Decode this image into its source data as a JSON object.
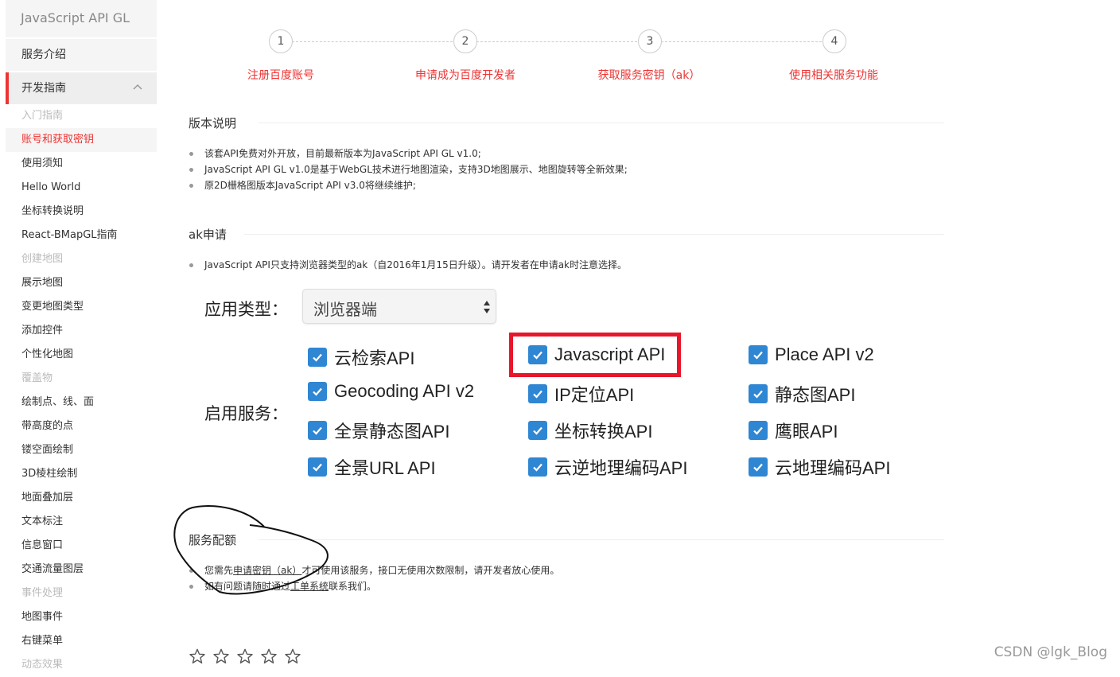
{
  "sidebar": {
    "brand": "JavaScript API GL",
    "top_items": [
      {
        "label": "服务介绍"
      },
      {
        "label": "开发指南"
      }
    ],
    "items": [
      {
        "label": "入门指南",
        "type": "category"
      },
      {
        "label": "账号和获取密钥",
        "type": "active"
      },
      {
        "label": "使用须知",
        "type": "item"
      },
      {
        "label": "Hello World",
        "type": "item"
      },
      {
        "label": "坐标转换说明",
        "type": "item"
      },
      {
        "label": "React-BMapGL指南",
        "type": "item"
      },
      {
        "label": "创建地图",
        "type": "category"
      },
      {
        "label": "展示地图",
        "type": "item"
      },
      {
        "label": "变更地图类型",
        "type": "item"
      },
      {
        "label": "添加控件",
        "type": "item"
      },
      {
        "label": "个性化地图",
        "type": "item"
      },
      {
        "label": "覆盖物",
        "type": "category"
      },
      {
        "label": "绘制点、线、面",
        "type": "item"
      },
      {
        "label": "带高度的点",
        "type": "item"
      },
      {
        "label": "镂空面绘制",
        "type": "item"
      },
      {
        "label": "3D棱柱绘制",
        "type": "item"
      },
      {
        "label": "地面叠加层",
        "type": "item"
      },
      {
        "label": "文本标注",
        "type": "item"
      },
      {
        "label": "信息窗口",
        "type": "item"
      },
      {
        "label": "交通流量图层",
        "type": "item"
      },
      {
        "label": "事件处理",
        "type": "category"
      },
      {
        "label": "地图事件",
        "type": "item"
      },
      {
        "label": "右键菜单",
        "type": "item"
      },
      {
        "label": "动态效果",
        "type": "category"
      }
    ]
  },
  "steps": [
    {
      "num": "1",
      "label": "注册百度账号"
    },
    {
      "num": "2",
      "label": "申请成为百度开发者"
    },
    {
      "num": "3",
      "label": "获取服务密钥（ak）"
    },
    {
      "num": "4",
      "label": "使用相关服务功能"
    }
  ],
  "version": {
    "title": "版本说明",
    "bullets": [
      "该套API免费对外开放，目前最新版本为JavaScript API GL v1.0;",
      "JavaScript API GL v1.0是基于WebGL技术进行地图渲染，支持3D地图展示、地图旋转等全新效果;",
      "原2D栅格图版本JavaScript API v3.0将继续维护;"
    ]
  },
  "ak": {
    "title": "ak申请",
    "bullet": "JavaScript API只支持浏览器类型的ak（自2016年1月15日升级）。请开发者在申请ak时注意选择。",
    "app_type_label": "应用类型：",
    "app_type_value": "浏览器端",
    "services_label": "启用服务：",
    "services": [
      {
        "label": "云检索API",
        "checked": true
      },
      {
        "label": "Javascript API",
        "checked": true,
        "highlighted": true
      },
      {
        "label": "Place API v2",
        "checked": true
      },
      {
        "label": "Geocoding API v2",
        "checked": true
      },
      {
        "label": "IP定位API",
        "checked": true
      },
      {
        "label": "静态图API",
        "checked": true
      },
      {
        "label": "全景静态图API",
        "checked": true
      },
      {
        "label": "坐标转换API",
        "checked": true
      },
      {
        "label": "鹰眼API",
        "checked": true
      },
      {
        "label": "全景URL API",
        "checked": true
      },
      {
        "label": "云逆地理编码API",
        "checked": true
      },
      {
        "label": "云地理编码API",
        "checked": true
      }
    ]
  },
  "quota": {
    "title": "服务配额",
    "line1_pre": "您需先",
    "line1_link": "申请密钥（ak）",
    "line1_post": "才可使用该服务，接口无使用次数限制，请开发者放心使用。",
    "line2_pre": "如有问题请随时通过",
    "line2_link": "工单系统",
    "line2_post": "联系我们。"
  },
  "rating": {
    "stars": 5,
    "value": 0
  },
  "watermark": "CSDN @lgk_Blog",
  "colors": {
    "accent": "#e33333",
    "checkbox": "#2f86d3",
    "highlight_frame": "#e8162b"
  }
}
